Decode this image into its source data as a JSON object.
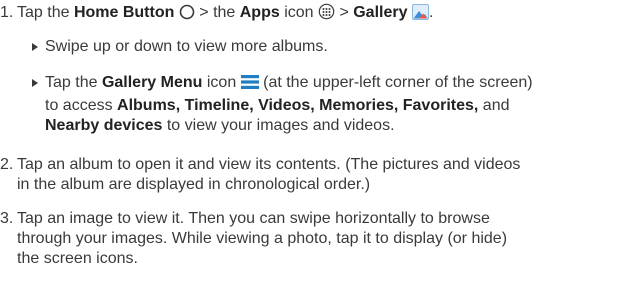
{
  "steps": [
    {
      "num": "1.",
      "t1": "Tap the ",
      "b1": "Home Button",
      "t2": " > the ",
      "b2": "Apps",
      "t3": " icon ",
      "t4": " > ",
      "b3": "Gallery",
      "t5": "."
    },
    {
      "num": "2.",
      "line1": "Tap an album to open it and view its contents. (The pictures and videos",
      "line2": "in the album are displayed in chronological order.)"
    },
    {
      "num": "3.",
      "line1": "Tap an image to view it. Then you can swipe horizontally to browse",
      "line2": "through your images. While viewing a photo, tap it to display (or hide)",
      "line3": "the screen icons."
    }
  ],
  "bullets": [
    {
      "text": "Swipe up or down to view more albums."
    },
    {
      "t1": "Tap the ",
      "b1": "Gallery Menu",
      "t2": " icon ",
      "t3": " (at the upper-left corner of the screen)",
      "t4": "to access ",
      "b2": "Albums, Timeline, Videos, Memories, Favorites,",
      "t5": " and",
      "b3": "Nearby devices",
      "t6": " to view your images and videos."
    }
  ],
  "icons": {
    "home": "circle-outline-icon",
    "apps": "apps-grid-icon",
    "gallery": "gallery-photo-icon",
    "menu": "hamburger-menu-icon"
  },
  "colors": {
    "menu_icon": "#1f7fc2",
    "gallery_bg": "#3b8fd6",
    "gallery_accent": "#e55a4e"
  }
}
